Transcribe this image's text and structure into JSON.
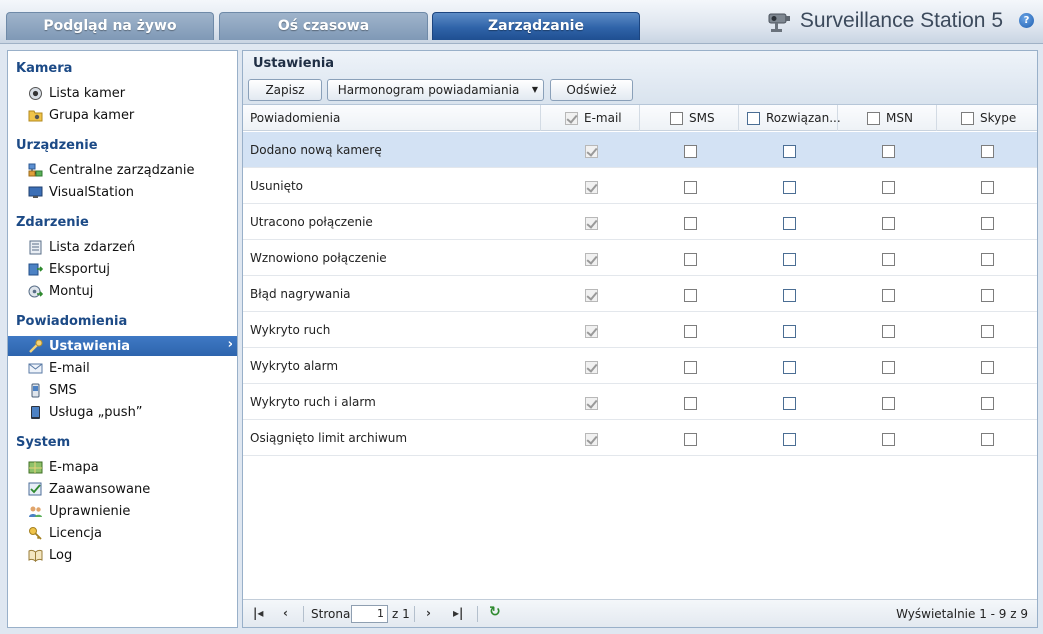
{
  "tabs": [
    {
      "label": "Podgląd na żywo"
    },
    {
      "label": "Oś czasowa"
    },
    {
      "label": "Zarządzanie",
      "active": true
    }
  ],
  "app_title": "Surveillance Station 5",
  "help_glyph": "?",
  "sidebar": {
    "sections": [
      {
        "title": "Kamera",
        "items": [
          {
            "label": "Lista kamer",
            "icon": "camera-icon"
          },
          {
            "label": "Grupa kamer",
            "icon": "folder-icon"
          }
        ]
      },
      {
        "title": "Urządzenie",
        "items": [
          {
            "label": "Centralne zarządzanie",
            "icon": "network-icon"
          },
          {
            "label": "VisualStation",
            "icon": "monitor-icon"
          }
        ]
      },
      {
        "title": "Zdarzenie",
        "items": [
          {
            "label": "Lista zdarzeń",
            "icon": "list-icon"
          },
          {
            "label": "Eksportuj",
            "icon": "export-icon"
          },
          {
            "label": "Montuj",
            "icon": "mount-icon"
          }
        ]
      },
      {
        "title": "Powiadomienia",
        "items": [
          {
            "label": "Ustawienia",
            "icon": "wrench-icon",
            "selected": true
          },
          {
            "label": "E-mail",
            "icon": "mail-icon"
          },
          {
            "label": "SMS",
            "icon": "phone-icon"
          },
          {
            "label": "Usługa „push”",
            "icon": "tablet-icon"
          }
        ]
      },
      {
        "title": "System",
        "items": [
          {
            "label": "E-mapa",
            "icon": "map-icon"
          },
          {
            "label": "Zaawansowane",
            "icon": "advanced-icon"
          },
          {
            "label": "Uprawnienie",
            "icon": "users-icon"
          },
          {
            "label": "Licencja",
            "icon": "key-icon"
          },
          {
            "label": "Log",
            "icon": "book-icon"
          }
        ]
      }
    ]
  },
  "panel": {
    "title": "Ustawienia",
    "buttons": {
      "save": "Zapisz",
      "schedule": "Harmonogram powiadamiania",
      "refresh": "Odśwież"
    },
    "columns": {
      "name": "Powiadomienia",
      "email": "E-mail",
      "sms": "SMS",
      "solution": "Rozwiązan...",
      "msn": "MSN",
      "skype": "Skype"
    },
    "rows": [
      {
        "label": "Dodano nową kamerę",
        "selected": true
      },
      {
        "label": "Usunięto"
      },
      {
        "label": "Utracono połączenie"
      },
      {
        "label": "Wznowiono połączenie"
      },
      {
        "label": "Błąd nagrywania"
      },
      {
        "label": "Wykryto ruch"
      },
      {
        "label": "Wykryto alarm"
      },
      {
        "label": "Wykryto ruch i alarm"
      },
      {
        "label": "Osiągnięto limit archiwum"
      }
    ],
    "pager": {
      "page_label": "Strona",
      "page_value": "1",
      "of_label": "z 1",
      "summary": "Wyświetalnie 1 - 9 z 9"
    }
  },
  "colors": {
    "accent": "#2d64ad",
    "section_title": "#1c4a86"
  }
}
